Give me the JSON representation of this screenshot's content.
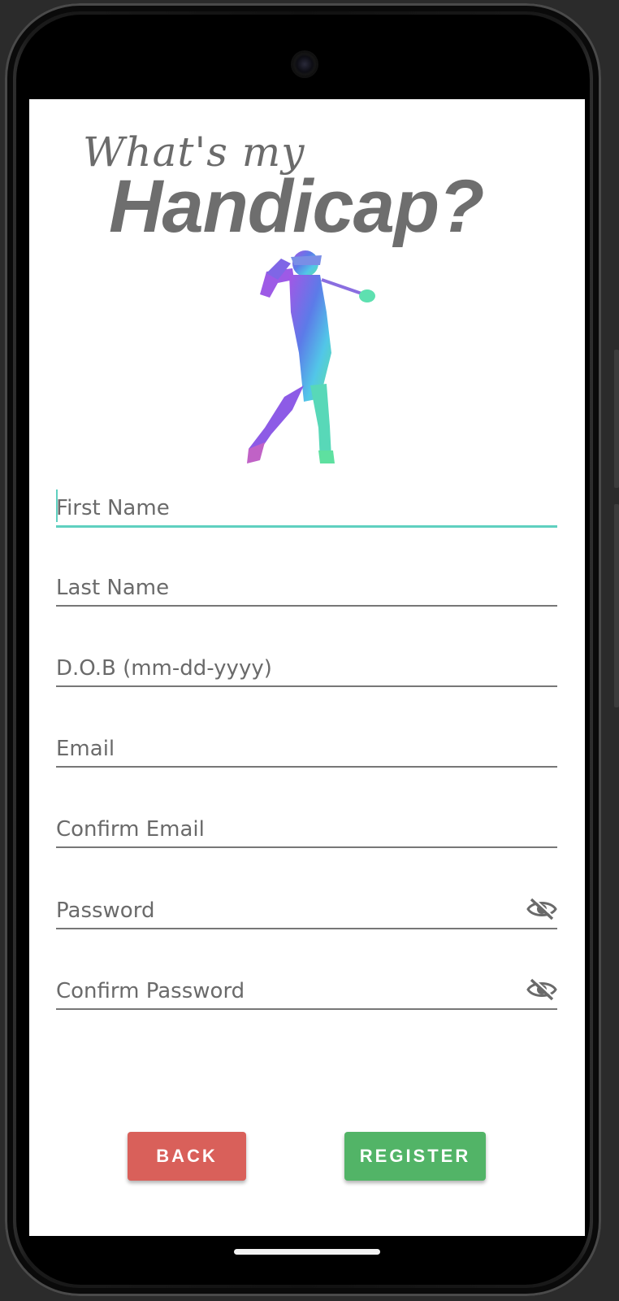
{
  "logo": {
    "script_text": "What's my",
    "main_text": "Handicap?"
  },
  "form": {
    "first_name_placeholder": "First Name",
    "last_name_placeholder": "Last Name",
    "dob_placeholder": "D.O.B (mm-dd-yyyy)",
    "email_placeholder": "Email",
    "confirm_email_placeholder": "Confirm Email",
    "password_placeholder": "Password",
    "confirm_password_placeholder": "Confirm Password",
    "password_toggle_icon": "eye-off-icon"
  },
  "buttons": {
    "back_label": "BACK",
    "register_label": "REGISTER"
  },
  "colors": {
    "accent": "#5fd0c0",
    "back": "#d9605a",
    "register": "#52b467",
    "logo": "#6e6e6e"
  }
}
